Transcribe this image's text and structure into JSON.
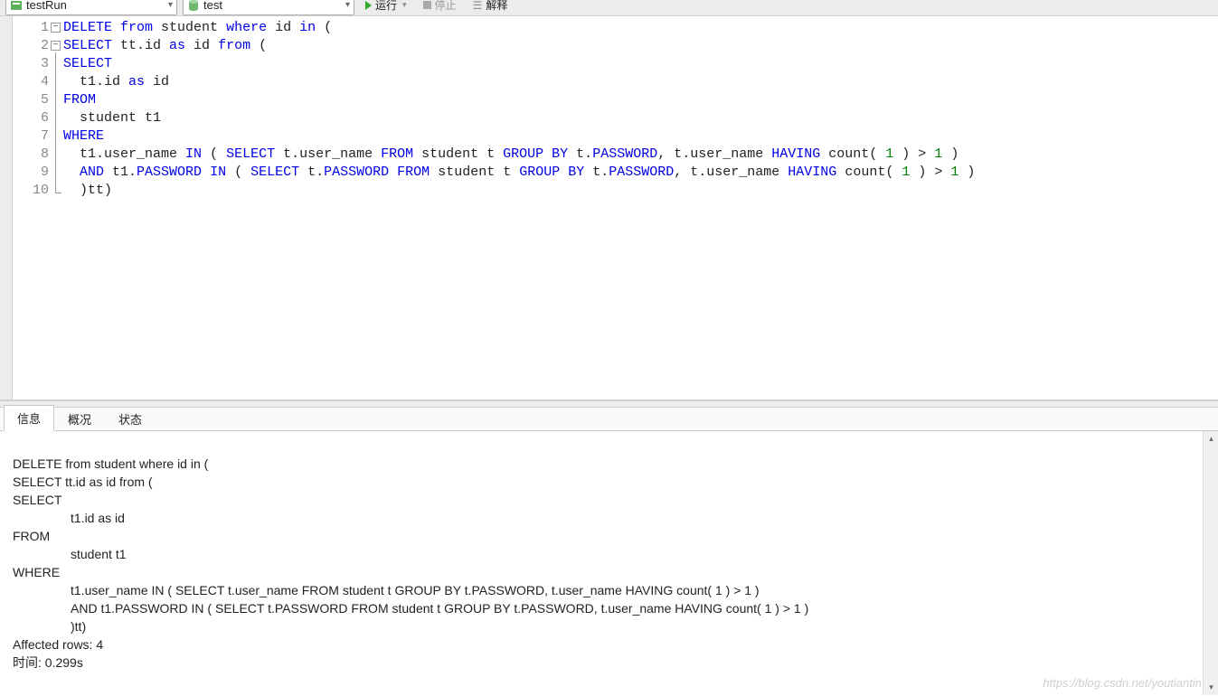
{
  "toolbar": {
    "conn_dropdown": "testRun",
    "db_dropdown": "test",
    "run_label": "运行",
    "stop_label": "停止",
    "explain_label": "解释"
  },
  "code_lines": [
    {
      "n": 1,
      "tokens": [
        {
          "t": "DELETE",
          "c": "kw"
        },
        {
          "t": " ",
          "c": "txt"
        },
        {
          "t": "from",
          "c": "kw"
        },
        {
          "t": " student ",
          "c": "txt"
        },
        {
          "t": "where",
          "c": "kw"
        },
        {
          "t": " id ",
          "c": "txt"
        },
        {
          "t": "in",
          "c": "kw"
        },
        {
          "t": " (",
          "c": "txt"
        }
      ]
    },
    {
      "n": 2,
      "tokens": [
        {
          "t": "SELECT",
          "c": "kw"
        },
        {
          "t": " tt.id ",
          "c": "txt"
        },
        {
          "t": "as",
          "c": "kw"
        },
        {
          "t": " id ",
          "c": "txt"
        },
        {
          "t": "from",
          "c": "kw"
        },
        {
          "t": " (",
          "c": "txt"
        }
      ]
    },
    {
      "n": 3,
      "tokens": [
        {
          "t": "SELECT",
          "c": "kw"
        }
      ]
    },
    {
      "n": 4,
      "tokens": [
        {
          "t": "  t1.id ",
          "c": "txt"
        },
        {
          "t": "as",
          "c": "kw"
        },
        {
          "t": " id",
          "c": "txt"
        }
      ]
    },
    {
      "n": 5,
      "tokens": [
        {
          "t": "FROM",
          "c": "kw"
        }
      ]
    },
    {
      "n": 6,
      "tokens": [
        {
          "t": "  student t1",
          "c": "txt"
        }
      ]
    },
    {
      "n": 7,
      "tokens": [
        {
          "t": "WHERE",
          "c": "kw"
        }
      ]
    },
    {
      "n": 8,
      "tokens": [
        {
          "t": "  t1.user_name ",
          "c": "txt"
        },
        {
          "t": "IN",
          "c": "kw"
        },
        {
          "t": " ( ",
          "c": "txt"
        },
        {
          "t": "SELECT",
          "c": "kw"
        },
        {
          "t": " t.user_name ",
          "c": "txt"
        },
        {
          "t": "FROM",
          "c": "kw"
        },
        {
          "t": " student t ",
          "c": "txt"
        },
        {
          "t": "GROUP BY",
          "c": "kw"
        },
        {
          "t": " t.",
          "c": "txt"
        },
        {
          "t": "PASSWORD",
          "c": "kw"
        },
        {
          "t": ", t.user_name ",
          "c": "txt"
        },
        {
          "t": "HAVING",
          "c": "kw"
        },
        {
          "t": " count( ",
          "c": "txt"
        },
        {
          "t": "1",
          "c": "gr"
        },
        {
          "t": " ) > ",
          "c": "txt"
        },
        {
          "t": "1",
          "c": "gr"
        },
        {
          "t": " )",
          "c": "txt"
        }
      ]
    },
    {
      "n": 9,
      "tokens": [
        {
          "t": "  ",
          "c": "txt"
        },
        {
          "t": "AND",
          "c": "kw"
        },
        {
          "t": " t1.",
          "c": "txt"
        },
        {
          "t": "PASSWORD",
          "c": "kw"
        },
        {
          "t": " ",
          "c": "txt"
        },
        {
          "t": "IN",
          "c": "kw"
        },
        {
          "t": " ( ",
          "c": "txt"
        },
        {
          "t": "SELECT",
          "c": "kw"
        },
        {
          "t": " t.",
          "c": "txt"
        },
        {
          "t": "PASSWORD",
          "c": "kw"
        },
        {
          "t": " ",
          "c": "txt"
        },
        {
          "t": "FROM",
          "c": "kw"
        },
        {
          "t": " student t ",
          "c": "txt"
        },
        {
          "t": "GROUP BY",
          "c": "kw"
        },
        {
          "t": " t.",
          "c": "txt"
        },
        {
          "t": "PASSWORD",
          "c": "kw"
        },
        {
          "t": ", t.user_name ",
          "c": "txt"
        },
        {
          "t": "HAVING",
          "c": "kw"
        },
        {
          "t": " count( ",
          "c": "txt"
        },
        {
          "t": "1",
          "c": "gr"
        },
        {
          "t": " ) > ",
          "c": "txt"
        },
        {
          "t": "1",
          "c": "gr"
        },
        {
          "t": " )",
          "c": "txt"
        }
      ]
    },
    {
      "n": 10,
      "tokens": [
        {
          "t": "  )tt)",
          "c": "txt"
        }
      ]
    }
  ],
  "tabs": {
    "info": "信息",
    "profile": "概况",
    "status": "状态"
  },
  "output": {
    "l1": "DELETE from student where id in (",
    "l2": "SELECT tt.id as id from (",
    "l3": "SELECT",
    "l4": "t1.id as id",
    "l5": "FROM",
    "l6": "student t1",
    "l7": "WHERE",
    "l8": "t1.user_name IN ( SELECT t.user_name FROM student t GROUP BY t.PASSWORD, t.user_name HAVING count( 1 ) > 1 )",
    "l9": "AND t1.PASSWORD IN ( SELECT t.PASSWORD FROM student t GROUP BY t.PASSWORD, t.user_name HAVING count( 1 ) > 1 )",
    "l10": ")tt)",
    "affected": "Affected rows: 4",
    "time": "时间: 0.299s"
  },
  "watermark": "https://blog.csdn.net/youtiantin"
}
